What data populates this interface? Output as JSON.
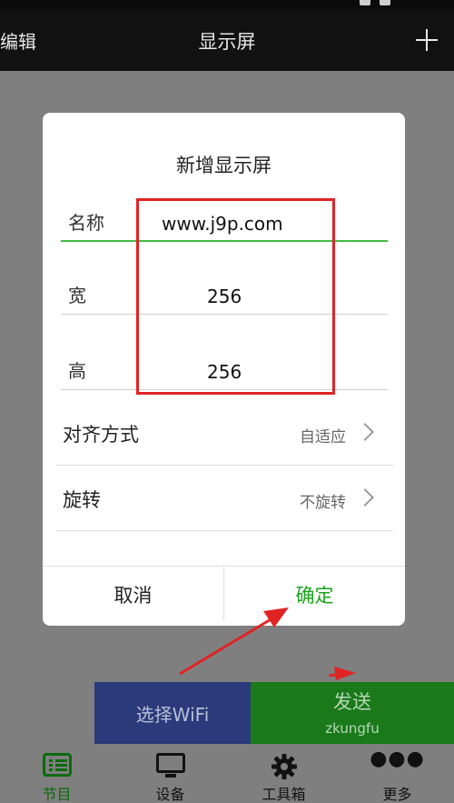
{
  "header": {
    "edit_label": "编辑",
    "title": "显示屏"
  },
  "dialog": {
    "title": "新增显示屏",
    "fields": [
      {
        "label": "名称",
        "value": "www.j9p.com"
      },
      {
        "label": "宽",
        "value": "256"
      },
      {
        "label": "高",
        "value": "256"
      }
    ],
    "rows": [
      {
        "label": "对齐方式",
        "value": "自适应"
      },
      {
        "label": "旋转",
        "value": "不旋转"
      }
    ],
    "cancel_label": "取消",
    "ok_label": "确定"
  },
  "actions": {
    "wifi_label": "选择WiFi",
    "send_label": "发送",
    "send_sub": "zkungfu"
  },
  "nav": {
    "items": [
      {
        "label": "节目",
        "icon": "list-icon",
        "active": true
      },
      {
        "label": "设备",
        "icon": "monitor-icon"
      },
      {
        "label": "工具箱",
        "icon": "gear-icon"
      },
      {
        "label": "更多",
        "icon": "more-dots-icon"
      }
    ]
  },
  "colors": {
    "accent_green": "#1aa51a",
    "annotation_red": "#e02424",
    "wifi_blue": "#2b3a7a",
    "send_green": "#1a7a1a"
  }
}
